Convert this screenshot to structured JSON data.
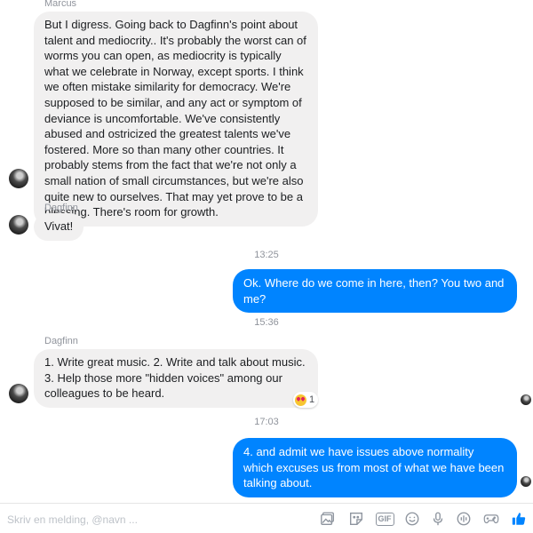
{
  "conversation": {
    "messages": [
      {
        "sender": "Marcus",
        "text": "But I digress. Going back to Dagfinn's point about talent and mediocrity.. It's probably the worst can of worms you can open, as mediocrity is typically what we celebrate in Norway, except sports. I think we often mistake similarity for democracy. We're supposed to be similar, and any act or symptom of deviance is uncomfortable. We've consistently abused and ostricized the greatest talents we've fostered. More so than many other countries. It probably stems from the fact that we're not only a small nation of small circumstances, but we're also quite new to ourselves. That may yet prove to be a blessing. There's room for growth."
      },
      {
        "sender": "Dagfinn",
        "text": "Vivat!"
      },
      {
        "timestamp": "13:25"
      },
      {
        "text": "Ok. Where do we come in here, then? You two and me?"
      },
      {
        "timestamp": "15:36"
      },
      {
        "sender": "Dagfinn",
        "text": "1. Write great music. 2. Write and talk about music. 3. Help those more \"hidden voices\" among our colleagues to be heard.",
        "reaction": {
          "emoji": "heart-eyes",
          "count": "1"
        }
      },
      {
        "timestamp": "17:03"
      },
      {
        "text": "4. and admit we have issues above normality which excuses us from most of what we have been talking about."
      }
    ]
  },
  "composer": {
    "placeholder": "Skriv en melding, @navn ...",
    "tools": [
      "image-icon",
      "sticker-icon",
      "gif-icon",
      "emoji-icon",
      "microphone-icon",
      "audio-icon",
      "game-controller-icon",
      "like-icon"
    ],
    "gif_label": "GIF"
  },
  "colors": {
    "outgoing_bubble": "#0084ff",
    "incoming_bubble": "#f1f0f0",
    "meta_text": "#90949c"
  }
}
